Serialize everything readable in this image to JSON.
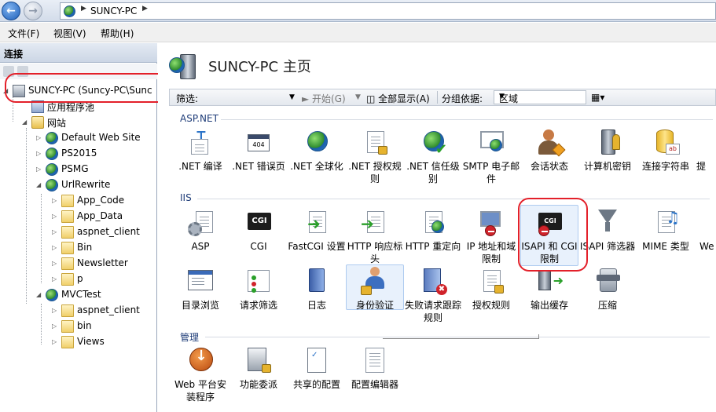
{
  "address": {
    "crumb": "SUNCY-PC"
  },
  "menu": [
    {
      "label": "文件(F)"
    },
    {
      "label": "视图(V)"
    },
    {
      "label": "帮助(H)"
    }
  ],
  "connections": {
    "title": "连接",
    "tree": [
      {
        "label": "SUNCY-PC (Suncy-PC\\Sunc"
      },
      {
        "label": "应用程序池"
      },
      {
        "label": "网站"
      },
      {
        "label": "Default Web Site"
      },
      {
        "label": "PS2015"
      },
      {
        "label": "PSMG"
      },
      {
        "label": "UrlRewrite"
      },
      {
        "label": "App_Code"
      },
      {
        "label": "App_Data"
      },
      {
        "label": "aspnet_client"
      },
      {
        "label": "Bin"
      },
      {
        "label": "Newsletter"
      },
      {
        "label": "p"
      },
      {
        "label": "MVCTest"
      },
      {
        "label": "aspnet_client"
      },
      {
        "label": "bin"
      },
      {
        "label": "Views"
      }
    ]
  },
  "page": {
    "title": "SUNCY-PC 主页"
  },
  "filter": {
    "label": "筛选:",
    "start": "开始(G)",
    "show_all": "全部显示(A)",
    "group_by_label": "分组依据:",
    "group_by_value": "区域"
  },
  "sections": {
    "aspnet": "ASP.NET",
    "iis": "IIS",
    "manage": "管理"
  },
  "features": {
    "aspnet": [
      {
        "label": ".NET 编译",
        "icon": "net-compile-icon"
      },
      {
        "label": ".NET 错误页",
        "icon": "net-error-page-icon"
      },
      {
        "label": ".NET 全球化",
        "icon": "net-globalization-icon"
      },
      {
        "label": ".NET 授权规则",
        "icon": "net-authorization-icon"
      },
      {
        "label": ".NET 信任级别",
        "icon": "net-trust-level-icon"
      },
      {
        "label": "SMTP 电子邮件",
        "icon": "smtp-email-icon"
      },
      {
        "label": "会话状态",
        "icon": "session-state-icon"
      },
      {
        "label": "计算机密钥",
        "icon": "machine-key-icon"
      },
      {
        "label": "连接字符串",
        "icon": "connection-strings-icon"
      },
      {
        "label": "提",
        "icon": "providers-icon"
      }
    ],
    "iis_row1": [
      {
        "label": "ASP",
        "icon": "asp-icon"
      },
      {
        "label": "CGI",
        "icon": "cgi-icon"
      },
      {
        "label": "FastCGI 设置",
        "icon": "fastcgi-icon"
      },
      {
        "label": "HTTP 响应标头",
        "icon": "http-response-headers-icon"
      },
      {
        "label": "HTTP 重定向",
        "icon": "http-redirect-icon"
      },
      {
        "label": "IP 地址和域限制",
        "icon": "ip-domain-restrictions-icon"
      },
      {
        "label": "ISAPI 和 CGI 限制",
        "icon": "isapi-cgi-restrictions-icon"
      },
      {
        "label": "ISAPI 筛选器",
        "icon": "isapi-filters-icon"
      },
      {
        "label": "MIME 类型",
        "icon": "mime-types-icon"
      },
      {
        "label": "We",
        "icon": "webdav-icon"
      }
    ],
    "iis_row2": [
      {
        "label": "目录浏览",
        "icon": "directory-browsing-icon"
      },
      {
        "label": "请求筛选",
        "icon": "request-filtering-icon"
      },
      {
        "label": "日志",
        "icon": "logging-icon"
      },
      {
        "label": "身份验证",
        "icon": "authentication-icon"
      },
      {
        "label": "失败请求跟踪规则",
        "icon": "failed-request-tracing-icon"
      },
      {
        "label": "授权规则",
        "icon": "authorization-rules-icon"
      },
      {
        "label": "输出缓存",
        "icon": "output-caching-icon"
      },
      {
        "label": "压缩",
        "icon": "compression-icon"
      }
    ],
    "manage": [
      {
        "label": "Web 平台安装程序",
        "icon": "web-platform-installer-icon"
      },
      {
        "label": "功能委派",
        "icon": "feature-delegation-icon"
      },
      {
        "label": "共享的配置",
        "icon": "shared-configuration-icon"
      },
      {
        "label": "配置编辑器",
        "icon": "configuration-editor-icon"
      }
    ]
  }
}
